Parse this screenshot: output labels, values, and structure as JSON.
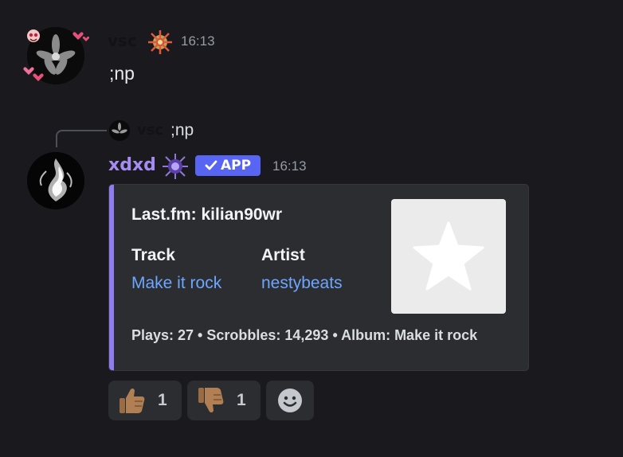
{
  "messages": [
    {
      "author": "vsc",
      "timestamp": "16:13",
      "content": ";np",
      "avatar_icon": "lily-avatar",
      "badge_icon": "compass-badge-icon"
    },
    {
      "author": "xdxd",
      "timestamp": "16:13",
      "app_badge": "APP",
      "avatar_icon": "smoke-avatar",
      "badge_icon": "purple-star-badge-icon",
      "reply": {
        "author": "vsc",
        "content": ";np"
      },
      "embed": {
        "accent_color": "#8f7cf0",
        "title": "Last.fm: kilian90wr",
        "fields": [
          {
            "name": "Track",
            "value": "Make it rock"
          },
          {
            "name": "Artist",
            "value": "nestybeats"
          }
        ],
        "footer": "Plays: 27 • Scrobbles: 14,293 • Album: Make it rock",
        "thumbnail_icon": "star-icon"
      },
      "reactions": [
        {
          "emoji": "thumbs-up-icon",
          "count": "1"
        },
        {
          "emoji": "thumbs-down-icon",
          "count": "1"
        },
        {
          "emoji": "add-reaction-icon"
        }
      ]
    }
  ],
  "colors": {
    "background": "#1a1a1e",
    "link": "#6ea6ff",
    "bot_name": "#a48cf0",
    "app_badge": "#5865f2"
  }
}
